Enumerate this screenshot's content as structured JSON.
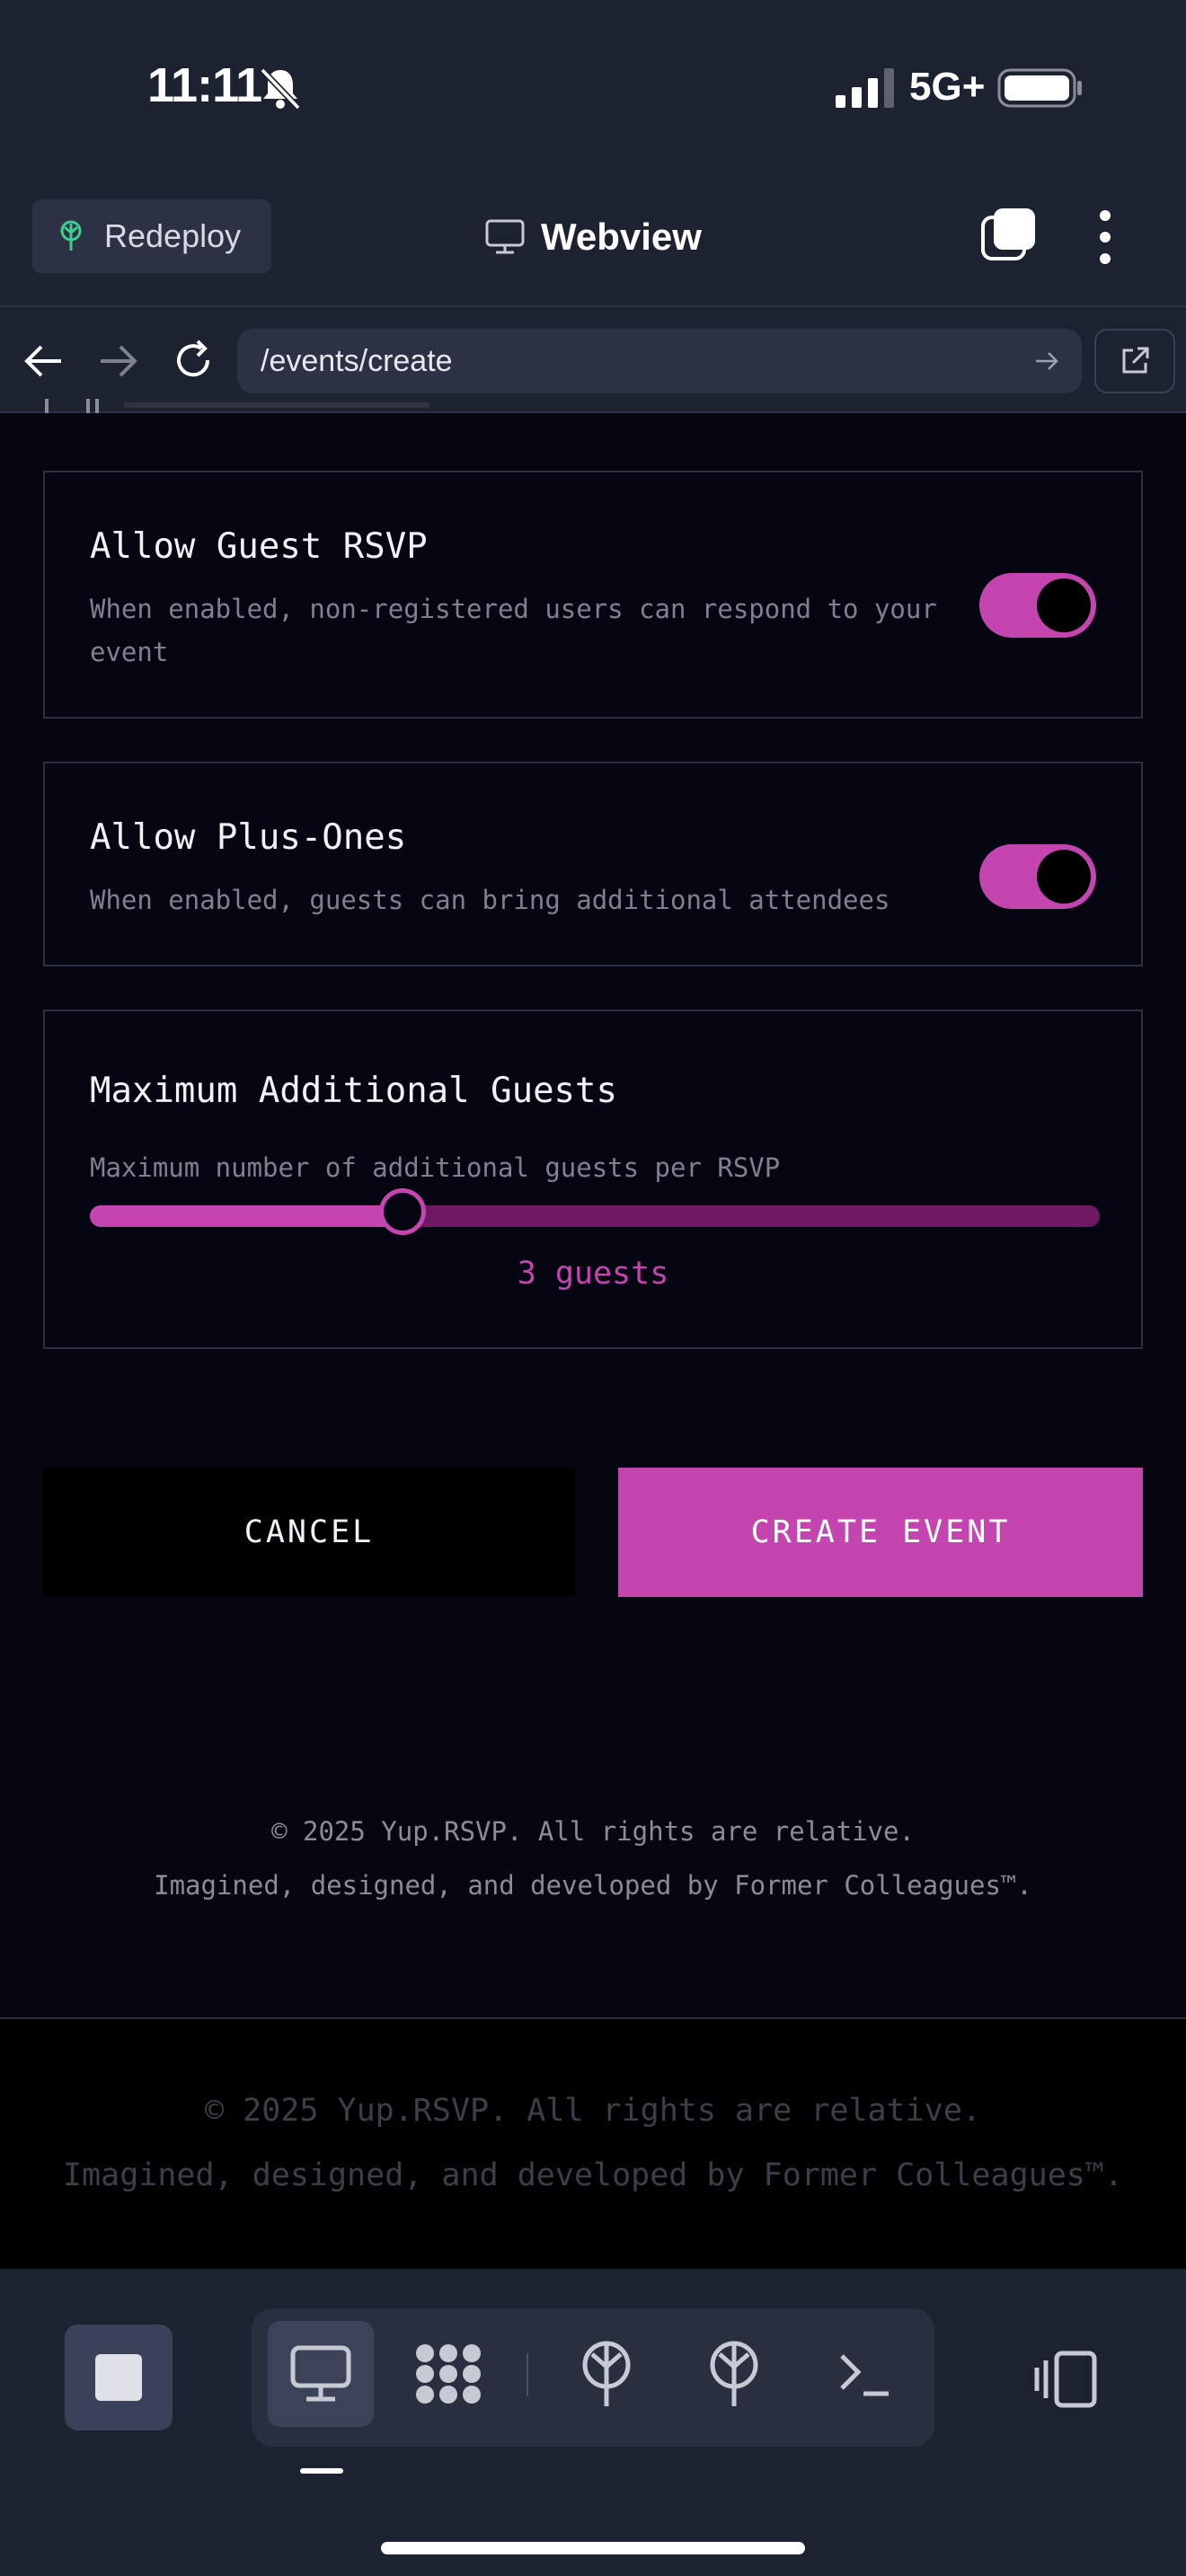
{
  "status_bar": {
    "time": "11:11",
    "network": "5G+"
  },
  "header": {
    "redeploy_label": "Redeploy",
    "title": "Webview"
  },
  "browser": {
    "url": "/events/create"
  },
  "settings": {
    "guest_rsvp": {
      "title": "Allow Guest RSVP",
      "description": "When enabled, non-registered users can respond to your event",
      "enabled": true
    },
    "plus_ones": {
      "title": "Allow Plus-Ones",
      "description": "When enabled, guests can bring additional attendees",
      "enabled": true
    },
    "max_guests": {
      "title": "Maximum Additional Guests",
      "description": "Maximum number of additional guests per RSVP",
      "value_label": "3 guests",
      "value_fraction": 0.31
    }
  },
  "actions": {
    "cancel_label": "CANCEL",
    "create_label": "CREATE EVENT"
  },
  "footer_inner": {
    "copyright": "© 2025 Yup.RSVP. All rights are relative.",
    "credit": "Imagined, designed, and developed by Former Colleagues™."
  },
  "footer_outer": {
    "copyright": "© 2025 Yup.RSVP. All rights are relative.",
    "credit": "Imagined, designed, and developed by Former Colleagues™."
  },
  "colors": {
    "accent": "#c445b0",
    "accent_dark": "#6e1961",
    "background": "#05060f",
    "chrome": "#1d2231"
  },
  "toolbar_icons": [
    "stop-icon",
    "monitor-icon",
    "apps-grid-icon",
    "deploy-tree-icon",
    "deploy-tree-icon",
    "terminal-icon",
    "side-panel-icon"
  ]
}
